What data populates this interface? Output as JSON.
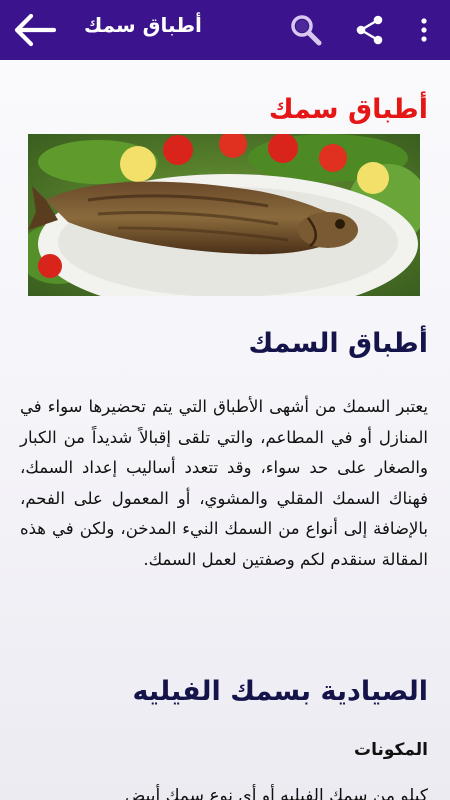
{
  "appbar": {
    "title": "أطباق سمك",
    "back_icon": "arrow-left-icon",
    "search_icon": "search-icon",
    "share_icon": "share-icon",
    "overflow_icon": "more-vert-icon",
    "color": "#3b148d"
  },
  "article": {
    "heading": "أطباق سمك",
    "heading_color": "#e41616",
    "hero_image": "grilled-fish-plate",
    "section1_title": "أطباق السمك",
    "intro": "يعتبر السمك من أشهى الأطباق التي يتم تحضيرها سواء في المنازل أو في المطاعم، والتي تلقى إقبالاً شديداً من الكبار والصغار على حد سواء، وقد تتعدد أساليب إعداد السمك، فهناك السمك المقلي والمشوي، أو المعمول على الفحم، بالإضافة إلى أنواع من السمك النيء المدخن، ولكن في هذه المقالة سنقدم لكم وصفتين لعمل السمك.",
    "section2_title": "الصيادية بسمك الفيليه",
    "ingredients_label": "المكونات",
    "next_line": "كيلو من سمك الفيليه أو أي نوع سمك أبيض"
  }
}
